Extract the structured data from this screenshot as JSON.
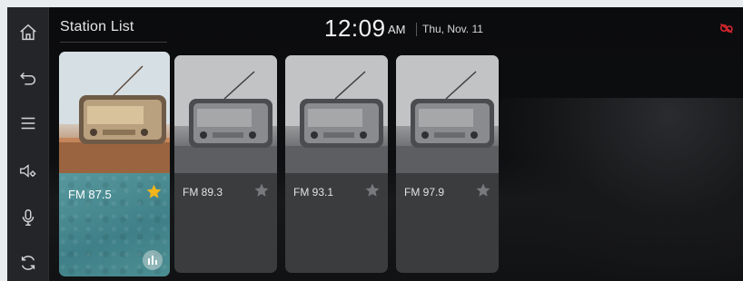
{
  "header": {
    "title": "Station List",
    "time": "12:09",
    "ampm": "AM",
    "date": "Thu, Nov. 11"
  },
  "sidebar": {
    "items": [
      {
        "name": "home",
        "icon": "home-icon"
      },
      {
        "name": "back",
        "icon": "back-arrow-icon"
      },
      {
        "name": "menu",
        "icon": "menu-icon"
      },
      {
        "name": "sound-settings",
        "icon": "speaker-gear-icon"
      },
      {
        "name": "voice",
        "icon": "microphone-icon"
      },
      {
        "name": "switch",
        "icon": "refresh-icon"
      }
    ]
  },
  "stations": [
    {
      "frequency": "FM 87.5",
      "favorite": true,
      "active": true
    },
    {
      "frequency": "FM 89.3",
      "favorite": false,
      "active": false
    },
    {
      "frequency": "FM 93.1",
      "favorite": false,
      "active": false
    },
    {
      "frequency": "FM 97.9",
      "favorite": false,
      "active": false
    }
  ],
  "colors": {
    "accent_teal": "#4a8e94",
    "favorite_star": "#f3b51c",
    "status_red": "#d3262e"
  }
}
